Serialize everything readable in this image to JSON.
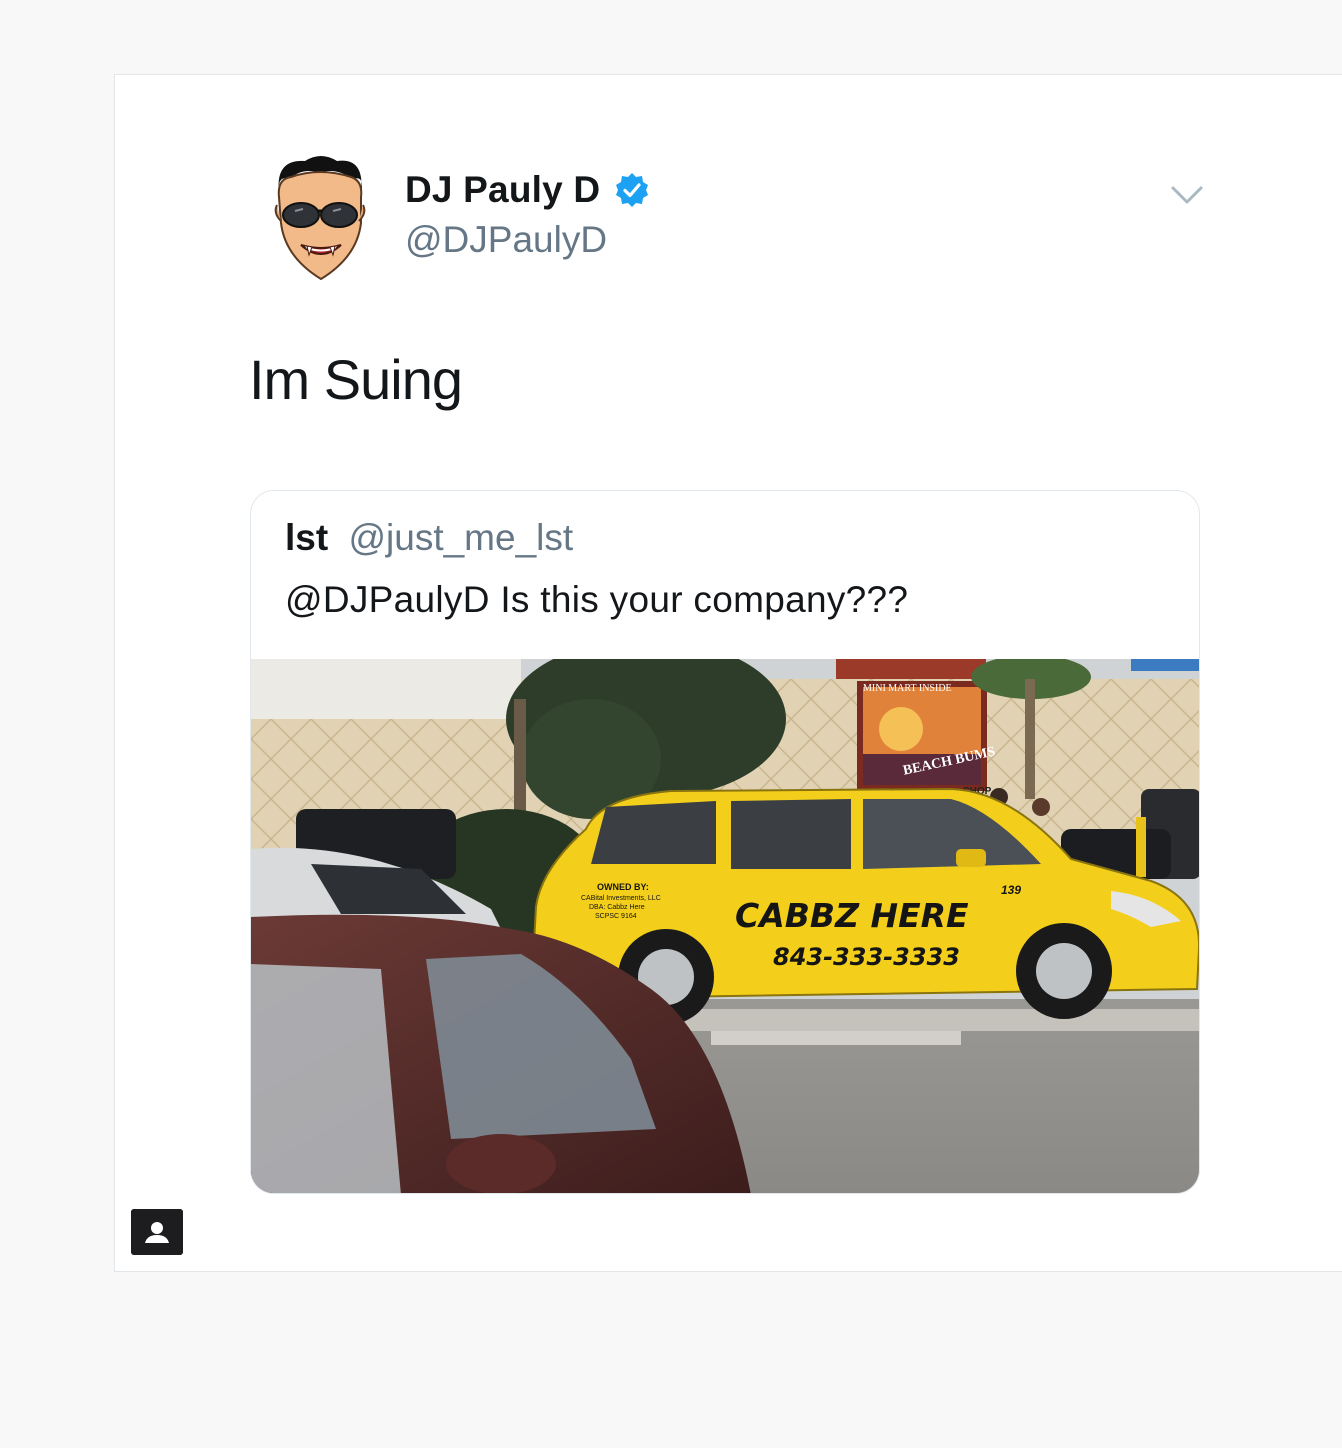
{
  "tweet": {
    "author_name": "DJ Pauly D",
    "author_handle": "@DJPaulyD",
    "text": "Im Suing"
  },
  "quoted_tweet": {
    "author_name": "lst",
    "author_handle": "@just_me_lst",
    "text": "@DJPaulyD Is this your company???",
    "photo": {
      "van_brand": "CABBZ HERE",
      "van_phone": "843-333-3333",
      "van_number": "139",
      "owned_by_lines": [
        "OWNED BY:",
        "CABital Investments, LLC",
        "DBA: Cabbz Here",
        "SCPSC 9164"
      ],
      "store_sign": "BEACH BUMS",
      "store_banner": "MINI MART  INSIDE",
      "store_label": "SHOP"
    }
  },
  "icons": {
    "verified": "verified-badge-icon",
    "menu": "chevron-down-icon",
    "profile": "profile-badge-icon"
  },
  "colors": {
    "verified_blue": "#1da1f2",
    "handle_gray": "#657786",
    "text_black": "#14171a",
    "taxi_yellow": "#f3cf1b"
  }
}
